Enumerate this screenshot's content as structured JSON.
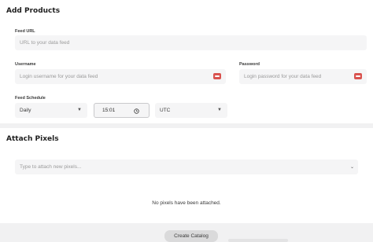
{
  "add_products": {
    "title": "Add Products",
    "feed_url": {
      "label": "Feed URL",
      "placeholder": "URL to your data feed"
    },
    "username": {
      "label": "Username",
      "placeholder": "Login username for your data feed"
    },
    "password": {
      "label": "Password",
      "placeholder": "Login password for your data feed"
    },
    "feed_schedule": {
      "label": "Feed Schedule",
      "frequency": "Daily",
      "time": "15:01",
      "timezone": "UTC"
    }
  },
  "attach_pixels": {
    "title": "Attach Pixels",
    "search_placeholder": "Type to attach new pixels...",
    "empty_message": "No pixels have been attached."
  },
  "footer": {
    "create_label": "Create Catalog"
  },
  "colors": {
    "password_manager_icon": "#d9534f",
    "page_background": "#f1f1f2",
    "card_background": "#ffffff"
  }
}
